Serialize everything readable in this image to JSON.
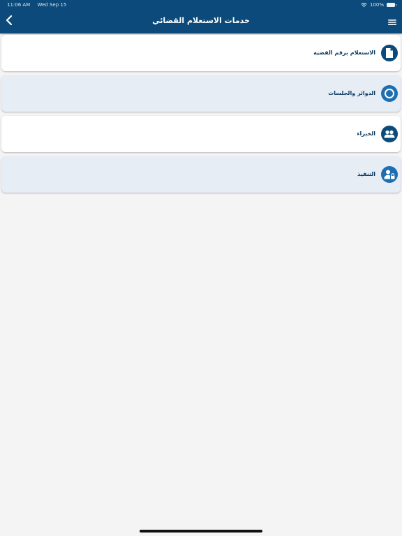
{
  "status_bar": {
    "time": "11:06 AM",
    "date": "Wed Sep 15",
    "battery": "100%"
  },
  "nav": {
    "title": "خدمات الاستعلام القضائي",
    "back_icon": "chevron-left-icon",
    "menu_icon": "hamburger-menu-icon"
  },
  "items": [
    {
      "label": "الاستعلام برقم القضية",
      "icon": "document-icon"
    },
    {
      "label": "الدوائر والجلسات",
      "icon": "circle-icon"
    },
    {
      "label": "الخبراء",
      "icon": "people-icon"
    },
    {
      "label": "التنفيذ",
      "icon": "user-lock-icon"
    }
  ],
  "colors": {
    "header": "#0b4a7a",
    "accent": "#1f6fb0",
    "item_alt": "#e7edf5"
  }
}
